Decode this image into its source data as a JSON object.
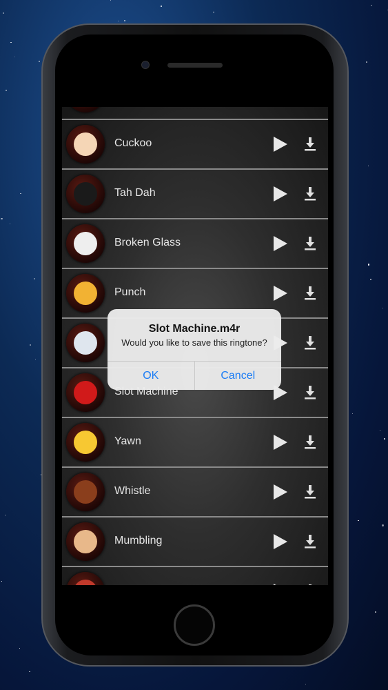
{
  "ringtones": [
    {
      "name": "",
      "icon": "unknown-icon",
      "color": "#f3a0b8"
    },
    {
      "name": "Cuckoo",
      "icon": "clown-icon",
      "color": "#f5d6b6"
    },
    {
      "name": "Tah Dah",
      "icon": "top-hat-icon",
      "color": "#1a1a1a"
    },
    {
      "name": "Broken Glass",
      "icon": "glass-icon",
      "color": "#eeeeee"
    },
    {
      "name": "Punch",
      "icon": "fist-icon",
      "color": "#f2b233"
    },
    {
      "name": "",
      "icon": "thunder-cloud-icon",
      "color": "#dfe6ee"
    },
    {
      "name": "Slot Machine",
      "icon": "joystick-icon",
      "color": "#d11a1a"
    },
    {
      "name": "Yawn",
      "icon": "sleepy-face-icon",
      "color": "#f7c832"
    },
    {
      "name": "Whistle",
      "icon": "football-icon",
      "color": "#8a3e1c"
    },
    {
      "name": "Mumbling",
      "icon": "old-man-icon",
      "color": "#e8b88a"
    },
    {
      "name": "",
      "icon": "unknown-icon",
      "color": "#c0392b"
    }
  ],
  "dialog": {
    "title": "Slot Machine.m4r",
    "message": "Would you like to save this ringtone?",
    "ok": "OK",
    "cancel": "Cancel"
  },
  "colors": {
    "accent": "#1a7cf5"
  }
}
